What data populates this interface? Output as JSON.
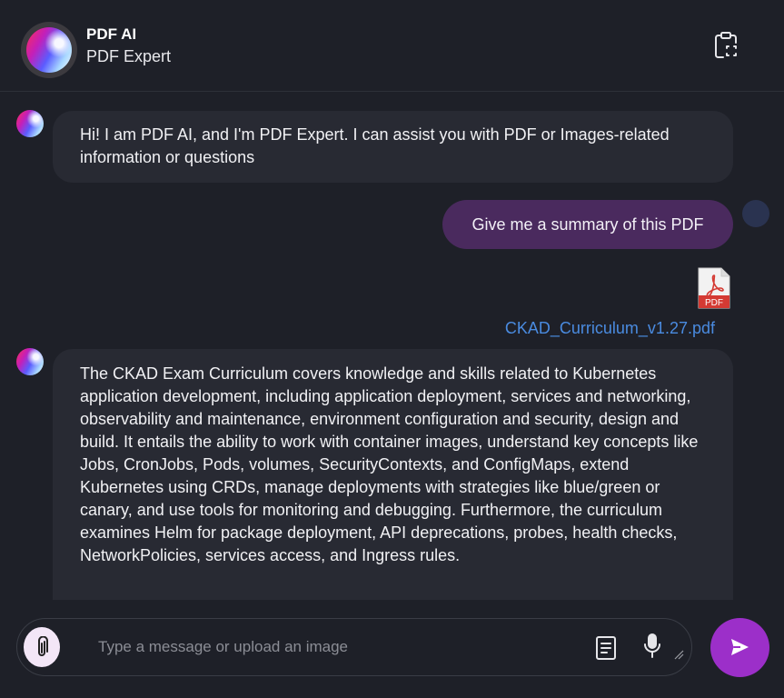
{
  "header": {
    "title": "PDF AI",
    "subtitle": "PDF Expert"
  },
  "messages": {
    "ai_greeting": "Hi! I am PDF AI, and I'm PDF Expert. I can assist you with PDF or Images-related information or questions",
    "user_prompt": "Give me a summary of this PDF",
    "attachment_filename": "CKAD_Curriculum_v1.27.pdf",
    "attachment_badge": "PDF",
    "ai_summary": "The CKAD Exam Curriculum covers knowledge and skills related to Kubernetes application development, including application deployment, services and networking, observability and maintenance, environment configuration and security, design and build. It entails the ability to work with container images, understand key concepts like Jobs, CronJobs, Pods, volumes, SecurityContexts, and ConfigMaps, extend Kubernetes using CRDs, manage deployments with strategies like blue/green or canary, and use tools for monitoring and debugging. Furthermore, the curriculum examines Helm for package deployment, API deprecations, probes, health checks, NetworkPolicies, services access, and Ingress rules."
  },
  "composer": {
    "placeholder": "Type a message or upload an image"
  },
  "colors": {
    "background": "#1e2028",
    "ai_bubble": "#282a33",
    "user_bubble": "#4a2a5e",
    "send_button": "#9c2fc9",
    "link": "#4a8be0",
    "pdf_red": "#d43a33"
  },
  "icons": [
    "clipboard-scan-icon",
    "paperclip-icon",
    "document-icon",
    "microphone-icon",
    "send-icon",
    "pdf-file-icon"
  ]
}
